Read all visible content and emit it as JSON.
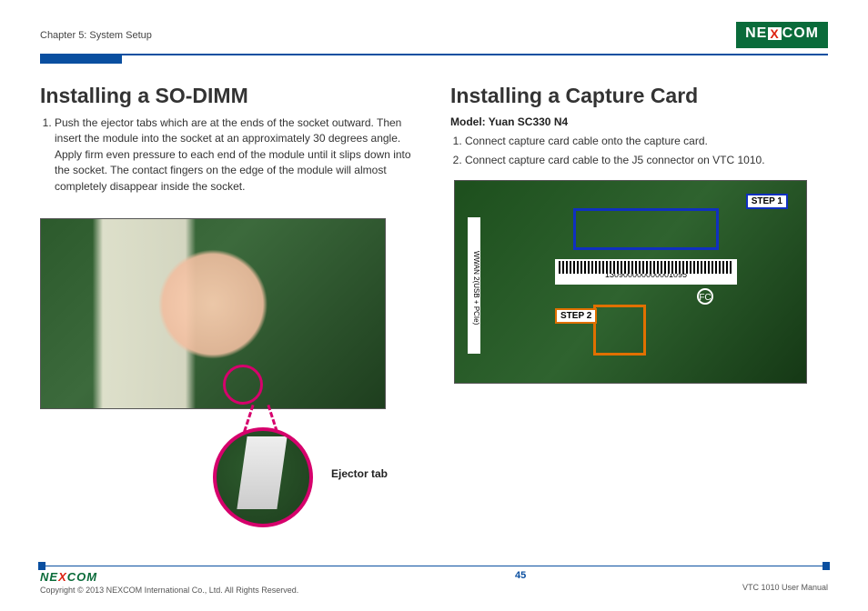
{
  "header": {
    "chapter": "Chapter 5: System Setup",
    "logo_text_left": "NE",
    "logo_text_x": "X",
    "logo_text_right": "COM"
  },
  "left": {
    "heading": "Installing a SO-DIMM",
    "steps": [
      "Push the ejector tabs which are at the ends of the socket outward. Then insert the module into the socket at an approximately 30 degrees angle. Apply firm even pressure to each end of the module until it slips down into the socket. The contact fingers on the edge of the module will almost completely disappear inside the socket."
    ],
    "detail_label": "Ejector tab"
  },
  "right": {
    "heading": "Installing a Capture Card",
    "model_label": "Model: Yuan SC330 N4",
    "steps": [
      "Connect capture card cable onto the capture card.",
      "Connect capture card cable to the J5 connector on VTC 1010."
    ],
    "step1_label": "STEP 1",
    "step2_label": "STEP 2",
    "barcode_number": "130900000000001095",
    "side_label": "WWAN 2(USB + PCIe)",
    "fcc": "FC"
  },
  "footer": {
    "logo_text_left": "NE",
    "logo_text_x": "X",
    "logo_text_right": "COM",
    "copyright": "Copyright © 2013 NEXCOM International Co., Ltd. All Rights Reserved.",
    "page_number": "45",
    "manual": "VTC 1010 User Manual"
  }
}
